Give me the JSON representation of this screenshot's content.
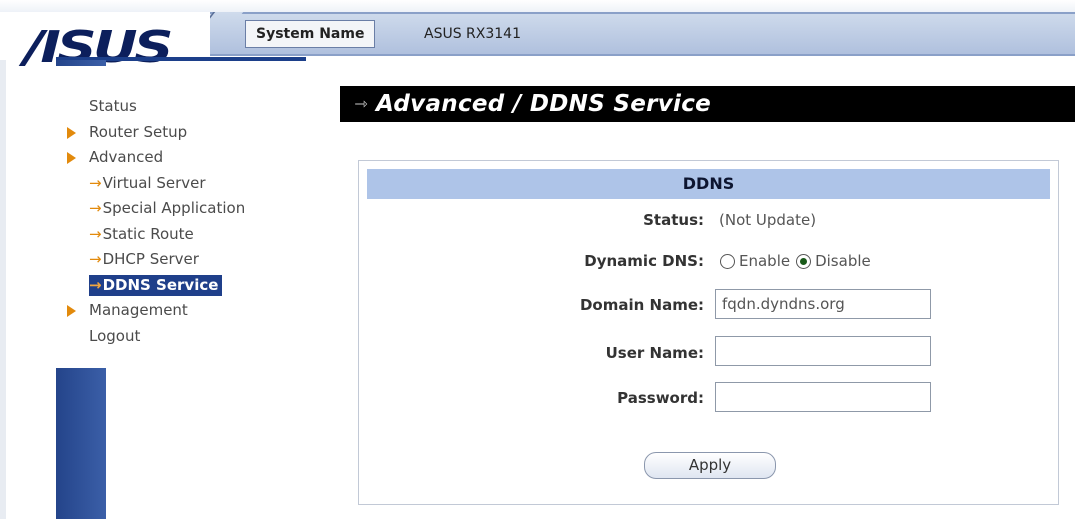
{
  "header": {
    "logo_text": "/ISUS",
    "system_name_label": "System Name",
    "system_name_value": "ASUS RX3141"
  },
  "sidebar": {
    "items": [
      {
        "label": "Status",
        "type": "top",
        "arrow": false
      },
      {
        "label": "Router Setup",
        "type": "top",
        "arrow": true
      },
      {
        "label": "Advanced",
        "type": "top",
        "arrow": true
      },
      {
        "label": "Virtual Server",
        "type": "sub"
      },
      {
        "label": "Special Application",
        "type": "sub"
      },
      {
        "label": "Static Route",
        "type": "sub"
      },
      {
        "label": "DHCP Server",
        "type": "sub"
      },
      {
        "label": "DDNS Service",
        "type": "sub",
        "active": true
      },
      {
        "label": "Management",
        "type": "top",
        "arrow": true
      },
      {
        "label": "Logout",
        "type": "top",
        "arrow": false
      }
    ],
    "sub_arrow_glyph": "→",
    "active_color": "#1f3f8a",
    "arrow_color": "#e28a0c"
  },
  "page": {
    "title": "Advanced / DDNS Service",
    "title_arrow_glyph": "⇾"
  },
  "ddns": {
    "header": "DDNS",
    "status_label": "Status:",
    "status_value": "(Not Update)",
    "dynamic_dns_label": "Dynamic DNS:",
    "dynamic_dns_options": [
      "Enable",
      "Disable"
    ],
    "dynamic_dns_selected": "Disable",
    "domain_name_label": "Domain Name:",
    "domain_name_value": "fqdn.dyndns.org",
    "user_name_label": "User Name:",
    "user_name_value": "",
    "password_label": "Password:",
    "password_value": "",
    "apply_label": "Apply"
  },
  "colors": {
    "header_bar": "#aebfdd",
    "panel_header": "#aec4e8",
    "title_bar": "#000000",
    "left_column": "#2b4d95"
  }
}
